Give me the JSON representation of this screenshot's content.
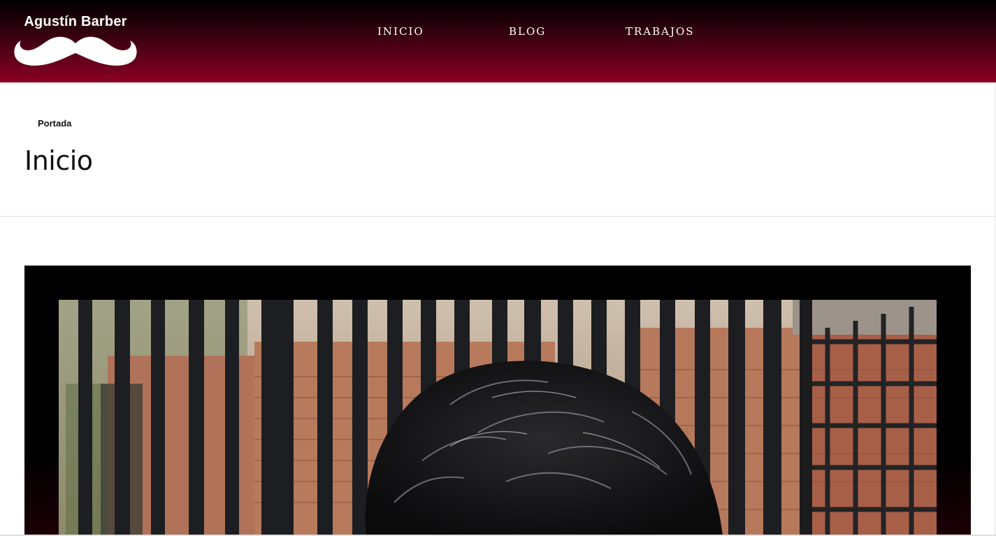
{
  "site": {
    "logo_text": "Agustín Barber",
    "logo_icon": "mustache-icon"
  },
  "nav": {
    "items": [
      {
        "label": "INICIO",
        "active": true
      },
      {
        "label": "BLOG",
        "active": false
      },
      {
        "label": "TRABAJOS",
        "active": false
      }
    ]
  },
  "breadcrumb": {
    "label": "Portada"
  },
  "page": {
    "title": "Inicio"
  },
  "colors": {
    "header_top": "#000000",
    "header_bottom": "#8c0024",
    "hero_frame": "#000000"
  }
}
